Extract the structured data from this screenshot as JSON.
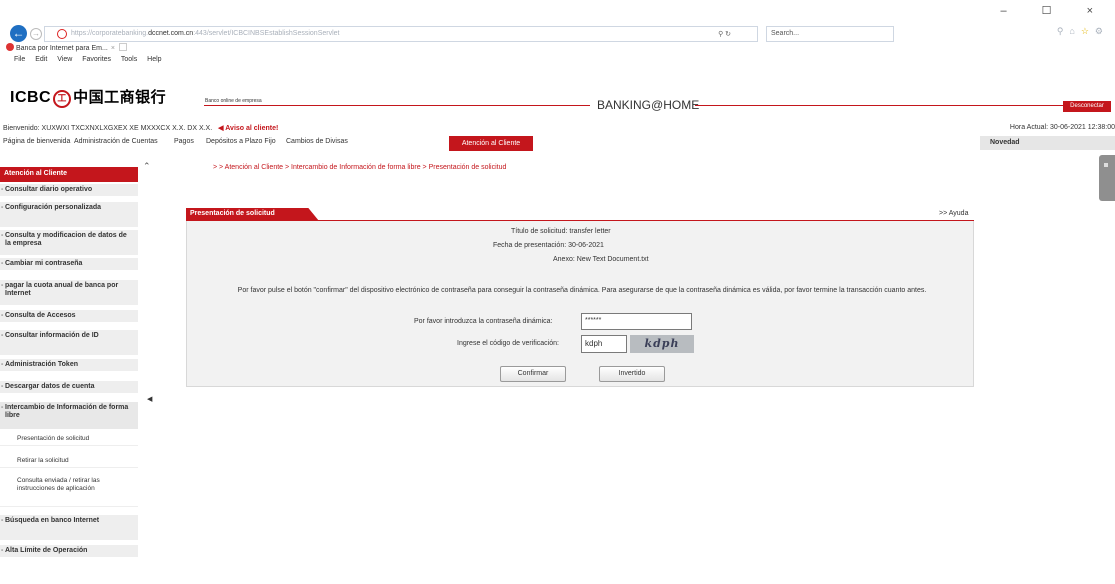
{
  "browser": {
    "url_scheme": "https",
    "url_host": "dccnet.com.cn",
    "search_placeholder": "Search...",
    "tab_title": "Banca por Internet para Em...",
    "tab_close": "×",
    "menu": [
      "File",
      "Edit",
      "View",
      "Favorites",
      "Tools",
      "Help"
    ],
    "window_controls": "– ☐ ×"
  },
  "bank": {
    "logo_text": "ICBC",
    "logo_seal": "工",
    "logo_cn": "中国工商银行",
    "subtitle": "Banco online de empresa",
    "brand_title": "BANKING@HOME",
    "logout_label": "Desconectar"
  },
  "welcome": {
    "text": "Bienvenido: XUXWXI TXCXNXLXGXEX XE MXXXCX X.X. DX X.X.",
    "alert": "Aviso al cliente!",
    "current_time": "Hora Actual: 30-06-2021 12:38:00"
  },
  "nav": {
    "items": [
      "Página de bienvenida",
      "Administración de Cuentas",
      "Pagos",
      "Depósitos a Plazo Fijo",
      "Cambios de Divisas"
    ],
    "active": "Atención al Cliente",
    "novedad": "Novedad"
  },
  "sidebar": {
    "title": "Atención al Cliente",
    "items": [
      "Consultar diario operativo",
      "Configuración personalizada",
      "Consulta y modificacion de datos de la empresa",
      "Cambiar mi contraseña",
      "pagar la cuota anual de banca por Internet",
      "Consulta de Accesos",
      "Consultar información de ID",
      "Administración Token",
      "Descargar datos de cuenta",
      "Intercambio de Información de forma libre"
    ],
    "sub_items": [
      "Presentación de solicitud",
      "Retirar la solicitud",
      "Consulta enviada / retirar las instrucciones de aplicación"
    ],
    "items_after": [
      "Búsqueda en banco Internet",
      "Alta Límite de Operación"
    ]
  },
  "content": {
    "breadcrumb": "> > Atención al Cliente > Intercambio de Información de forma libre > Presentación de solicitud",
    "panel_title": "Presentación de solicitud",
    "help": ">> Ayuda",
    "fields": {
      "title_label": "Título de solicitud:",
      "title_value": "transfer letter",
      "date_label": "Fecha de presentación:",
      "date_value": "30-06-2021",
      "annex_label": "Anexo:",
      "annex_value": "New Text Document.txt"
    },
    "instruction": "Por favor pulse el botón \"confirmar\" del dispositivo electrónico de contraseña para conseguir la contraseña dinámica. Para asegurarse de que la contraseña dinámica es válida, por favor termine la transacción cuanto antes.",
    "password_label": "Por favor introduzca la contraseña dinámica:",
    "password_value": "******",
    "code_label": "Ingrese el código de verificación:",
    "code_value": "kdph",
    "captcha_text": "kdph",
    "confirm_label": "Confirmar",
    "cancel_label": "Invertido"
  }
}
